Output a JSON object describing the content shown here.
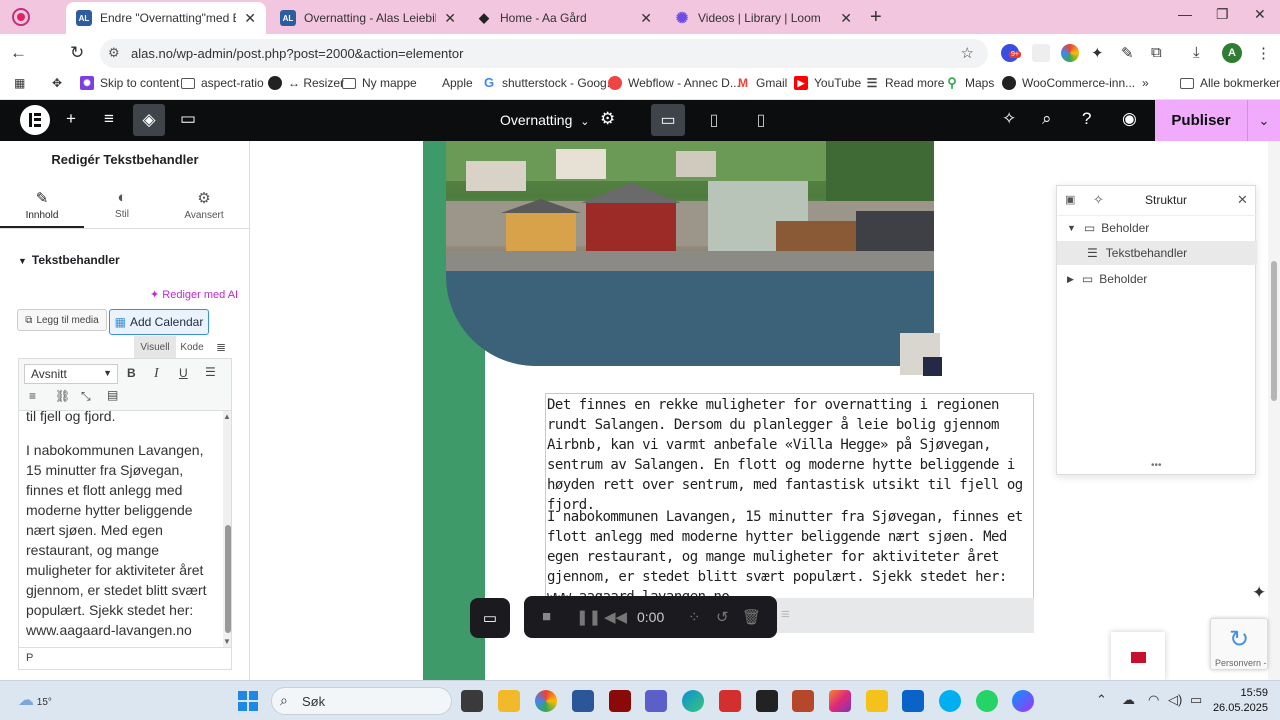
{
  "browser": {
    "tabs": [
      {
        "title": "Endre \"Overnatting\"med Elementor",
        "favicon": "AL",
        "active": true
      },
      {
        "title": "Overnatting - Alas Leiebil",
        "favicon": "AL",
        "active": false
      },
      {
        "title": "Home - Aa Gård",
        "favicon": "◆",
        "active": false
      },
      {
        "title": "Videos | Library | Loom",
        "favicon": "✺",
        "active": false
      }
    ],
    "url": "alas.no/wp-admin/post.php?post=2000&action=elementor",
    "bookmarks": [
      "Skip to content",
      "aspect-ratio",
      "↔ Resizer",
      "Ny mappe",
      "Apple",
      "shutterstock - Goog...",
      "Webflow - Annec D...",
      "Gmail",
      "YouTube",
      "Read more",
      "Maps",
      "WooCommerce-inn..."
    ],
    "all_bookmarks": "Alle bokmerker",
    "profile_initial": "A",
    "extension_badge": "9+"
  },
  "elementor": {
    "page_name": "Overnatting",
    "publish_label": "Publiser"
  },
  "panel": {
    "title": "Redigér Tekstbehandler",
    "tabs": [
      "Innhold",
      "Stil",
      "Avansert"
    ],
    "section": "Tekstbehandler",
    "ai_link": "Rediger med AI",
    "add_media": "Legg til media",
    "add_calendar": "Add Calendar",
    "view_tabs": [
      "Visuell",
      "Kode"
    ],
    "format_select": "Avsnitt",
    "editor_top": "til fjell og fjord.",
    "editor_para": "I nabokommunen Lavangen, 15 minutter fra Sjøvegan, finnes et flott anlegg med moderne hytter beliggende nært sjøen. Med egen restaurant, og mange muligheter for aktiviteter året gjennom, er stedet blitt svært populært. Sjekk stedet her: www.aagaard-lavangen.no",
    "path": "P"
  },
  "canvas": {
    "para1": "Det finnes en rekke muligheter for overnatting i regionen rundt Salangen. Dersom du planlegger å leie bolig gjennom Airbnb, kan vi varmt anbefale «Villa Hegge» på Sjøvegan, sentrum av Salangen. En flott og moderne hytte beliggende i høyden rett over sentrum, med fantastisk utsikt til fjell og fjord.",
    "para2": "I nabokommunen Lavangen, 15 minutter fra Sjøvegan, finnes et flott anlegg med moderne hytter beliggende nært sjøen. Med egen restaurant, og mange muligheter for aktiviteter året gjennom, er stedet blitt svært populært. Sjekk stedet her: www.aagaard-lavangen.no",
    "accent_color": "#3f9a6a"
  },
  "structure": {
    "title": "Struktur",
    "items": [
      "Beholder",
      "Tekstbehandler",
      "Beholder"
    ]
  },
  "recorder": {
    "time": "0:00"
  },
  "recaptcha": {
    "text": "Personvern -"
  },
  "taskbar": {
    "weather": "15°",
    "search": "Søk",
    "time": "15:59",
    "date": "26.05.2025"
  }
}
